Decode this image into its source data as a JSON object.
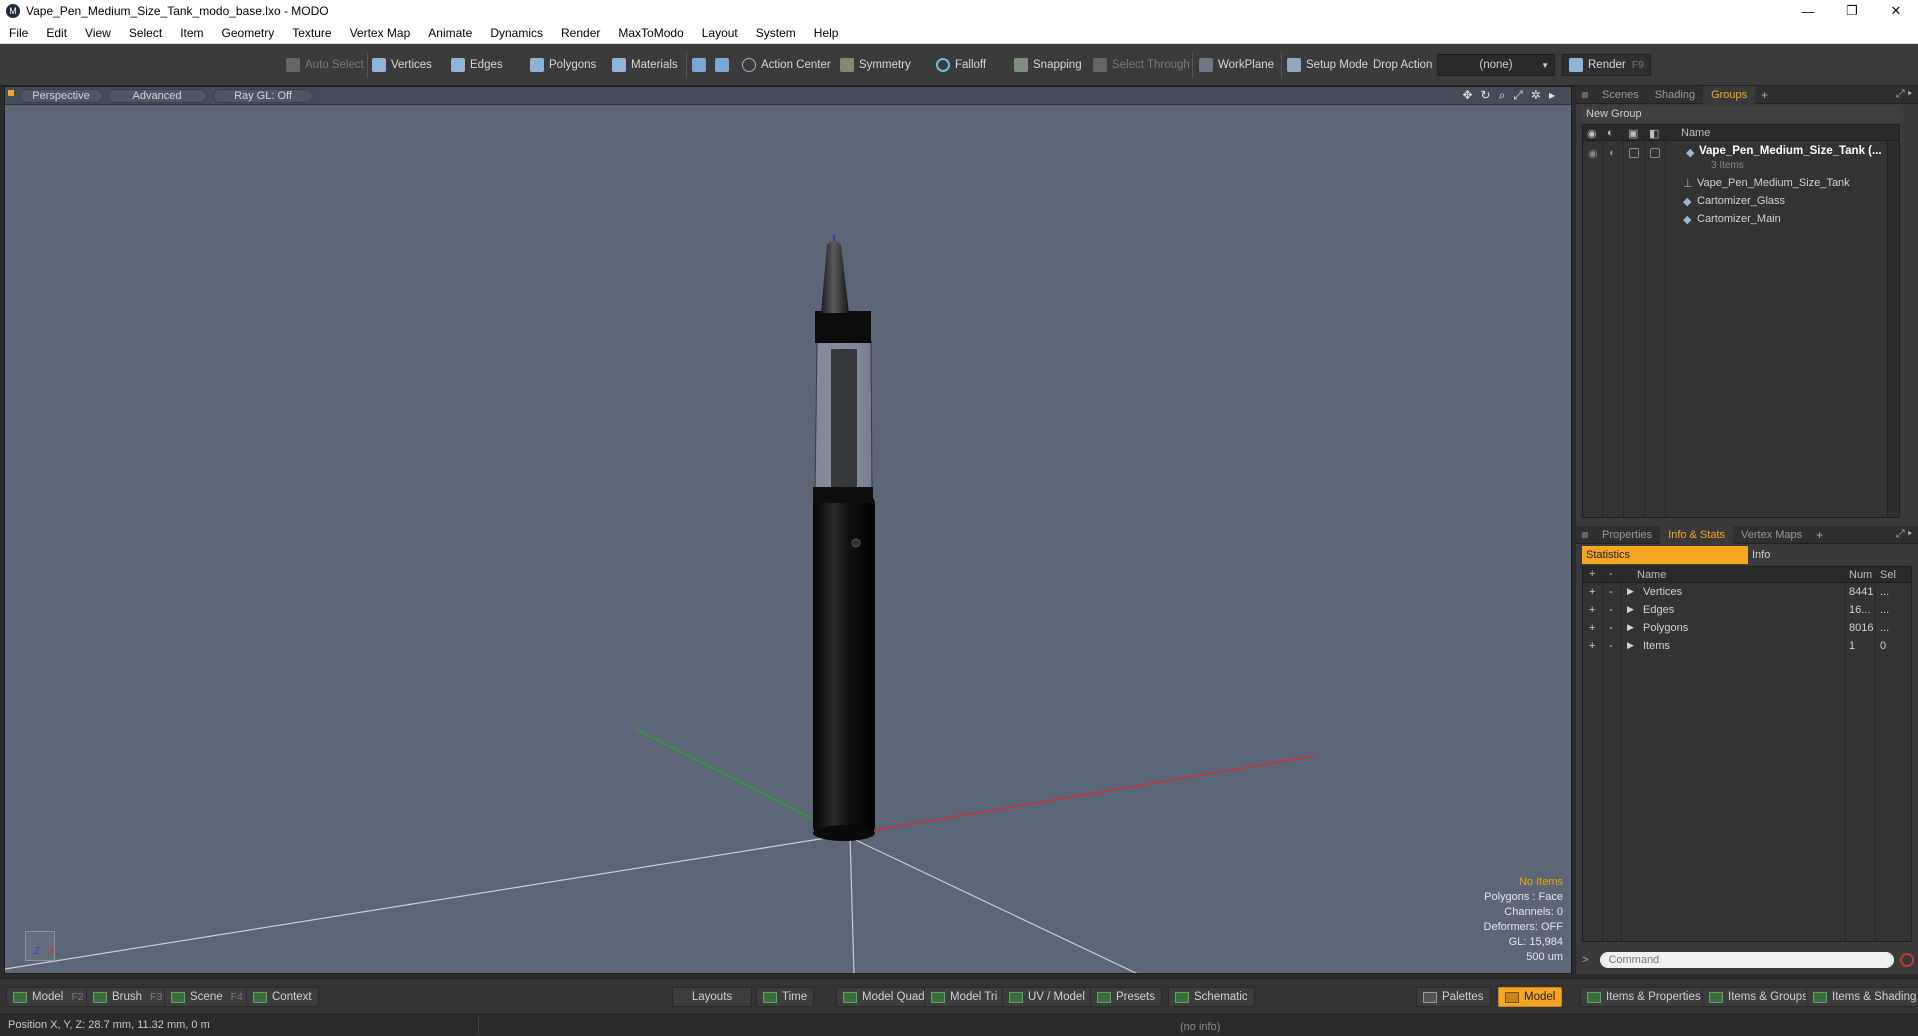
{
  "window": {
    "title": "Vape_Pen_Medium_Size_Tank_modo_base.lxo - MODO",
    "minimize": "—",
    "maximize": "❐",
    "close": "✕"
  },
  "menu": [
    "File",
    "Edit",
    "View",
    "Select",
    "Item",
    "Geometry",
    "Texture",
    "Vertex Map",
    "Animate",
    "Dynamics",
    "Render",
    "MaxToModo",
    "Layout",
    "System",
    "Help"
  ],
  "toolbar": {
    "auto_select": "Auto Select",
    "vertices": "Vertices",
    "edges": "Edges",
    "polygons": "Polygons",
    "materials": "Materials",
    "action_center": "Action Center",
    "symmetry": "Symmetry",
    "falloff": "Falloff",
    "snapping": "Snapping",
    "select_through": "Select Through",
    "workplane": "WorkPlane",
    "setup_mode": "Setup Mode",
    "drop_action": "Drop Action",
    "drop_value": "(none)",
    "render": "Render",
    "render_key": "F9"
  },
  "viewport": {
    "view_label": "Perspective",
    "advanced_label": "Advanced",
    "raygl_label": "Ray GL: Off",
    "stats": {
      "no_items": "No Items",
      "polygons": "Polygons : Face",
      "channels": "Channels: 0",
      "deformers": "Deformers: OFF",
      "gl": "GL: 15,984",
      "scale": "500 um"
    },
    "gizmo_z": "Z",
    "gizmo_x": "X"
  },
  "scene_panel": {
    "tabs": [
      "Scenes",
      "Shading",
      "Groups"
    ],
    "active_tab": "Groups",
    "new_group": "New Group",
    "name_col": "Name",
    "root": {
      "name": "Vape_Pen_Medium_Size_Tank (...",
      "sub": "3 Items"
    },
    "children": [
      "Vape_Pen_Medium_Size_Tank",
      "Cartomizer_Glass",
      "Cartomizer_Main"
    ]
  },
  "info_panel": {
    "tabs": [
      "Properties",
      "Info & Stats",
      "Vertex Maps"
    ],
    "active_tab": "Info & Stats",
    "statistics": "Statistics",
    "info": "Info",
    "headers": {
      "name": "Name",
      "num": "Num",
      "sel": "Sel"
    },
    "rows": [
      {
        "name": "Vertices",
        "num": "8441",
        "sel": "..."
      },
      {
        "name": "Edges",
        "num": "16...",
        "sel": "..."
      },
      {
        "name": "Polygons",
        "num": "8016",
        "sel": "..."
      },
      {
        "name": "Items",
        "num": "1",
        "sel": "0"
      }
    ],
    "command_placeholder": "Command"
  },
  "bottom": {
    "model": "Model",
    "model_key": "F2",
    "brush": "Brush",
    "brush_key": "F3",
    "scene": "Scene",
    "scene_key": "F4",
    "context": "Context",
    "layouts": "Layouts",
    "time": "Time",
    "model_quad": "Model Quad",
    "model_tri": "Model Tri",
    "uv_model": "UV / Model",
    "presets": "Presets",
    "schematic": "Schematic",
    "palettes": "Palettes",
    "model_tab": "Model",
    "items_properties": "Items & Properties",
    "items_groups": "Items & Groups",
    "items_shading": "Items & Shading"
  },
  "status": {
    "position": "Position X, Y, Z:   28.7 mm, 11.32 mm, 0 m",
    "info": "(no info)"
  },
  "colors": {
    "accent": "#f5a623",
    "viewport_bg": "#5b6677",
    "axis_x": "#d03030",
    "axis_y": "#2ea02e",
    "axis_z": "#2b2bd8"
  }
}
